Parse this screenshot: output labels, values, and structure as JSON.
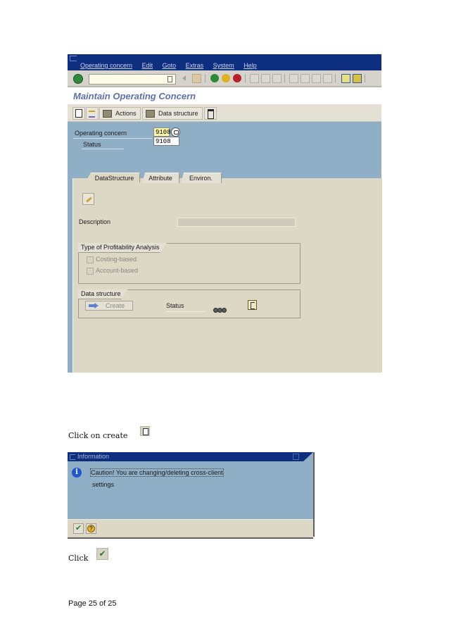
{
  "sap_window": {
    "menubar": {
      "items": [
        "Operating concern",
        "Edit",
        "Goto",
        "Extras",
        "System",
        "Help"
      ]
    },
    "standard_toolbar": {
      "command_field_value": "",
      "icons": [
        "enter-icon",
        "command-field-dropdown-icon",
        "back-nav-icon",
        "save-icon",
        "back-icon",
        "exit-icon",
        "cancel-icon",
        "print-icon",
        "find-icon",
        "find-next-icon",
        "first-page-icon",
        "previous-page-icon",
        "next-page-icon",
        "last-page-icon",
        "new-session-icon",
        "shortcut-icon"
      ]
    },
    "title": "Maintain Operating Concern",
    "app_toolbar": {
      "actions_label": "Actions",
      "data_structure_label": "Data structure"
    },
    "selection": {
      "operating_concern_label": "Operating concern",
      "operating_concern_value": "9108",
      "status_label": "Status",
      "dropdown_option": "9108"
    },
    "tabs": [
      {
        "label": "DataStructure",
        "active": true
      },
      {
        "label": "Attribute",
        "active": false
      },
      {
        "label": "Environ.",
        "active": false
      }
    ],
    "datastructure_tab": {
      "description_label": "Description",
      "description_value": "",
      "profitability_group": {
        "title": "Type of Profitability Analysis",
        "options": [
          {
            "label": "Costing-based",
            "checked": false,
            "enabled": false
          },
          {
            "label": "Account-based",
            "checked": false,
            "enabled": false
          }
        ]
      },
      "data_structure_group": {
        "title": "Data structure",
        "create_label": "Create",
        "status_label": "Status",
        "status_lights": "inactive"
      }
    }
  },
  "instructions": {
    "step1": "Click on create",
    "step2": "Click"
  },
  "info_dialog": {
    "title": "Information",
    "message_line1": "Caution! You are changing/deleting cross-client",
    "message_line2": "settings",
    "buttons": [
      "continue-check-icon",
      "help-icon"
    ]
  },
  "footer": {
    "page_text": "Page 25 of 25"
  },
  "colors": {
    "title_bar": "#0e2f7f",
    "screen_background": "#8fafc6",
    "panel_background": "#ddd7c6",
    "title_text": "#5d6fb0",
    "input_highlight": "#fff7a8"
  }
}
